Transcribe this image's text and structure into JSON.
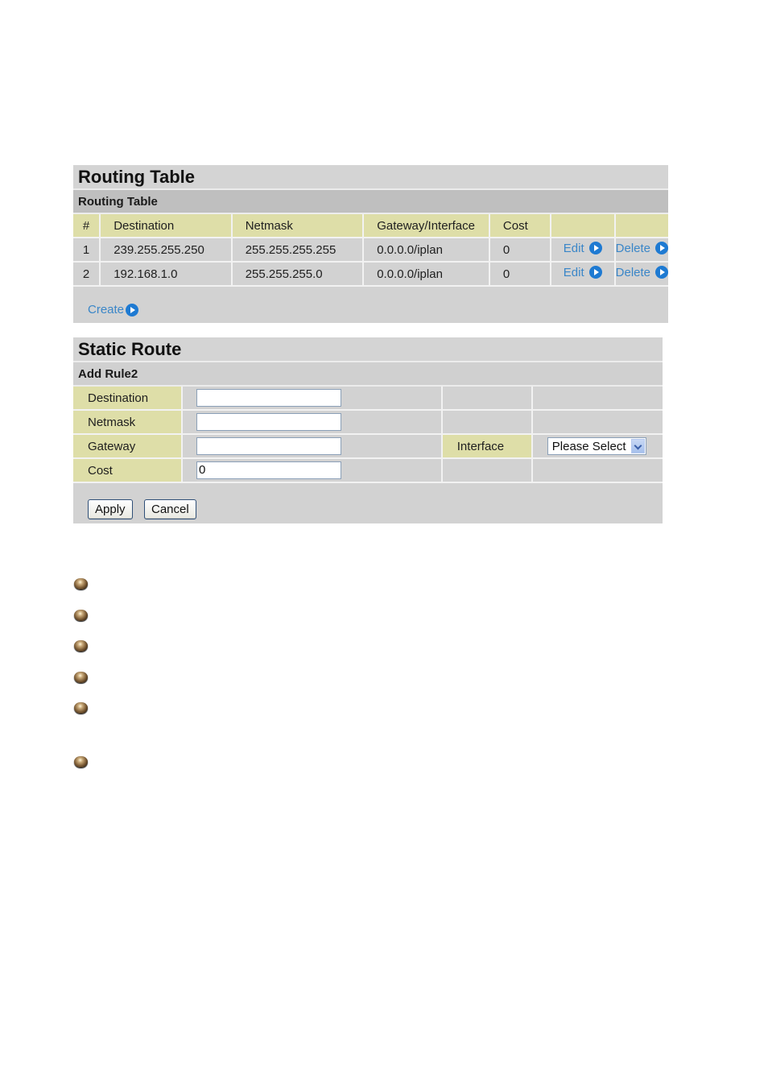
{
  "routing_table": {
    "title": "Routing Table",
    "subtitle": "Routing Table",
    "columns": [
      "#",
      "Destination",
      "Netmask",
      "Gateway/Interface",
      "Cost",
      "",
      ""
    ],
    "rows": [
      {
        "num": "1",
        "destination": "239.255.255.250",
        "netmask": "255.255.255.255",
        "gateway": "0.0.0.0/iplan",
        "cost": "0",
        "edit": "Edit",
        "delete": "Delete"
      },
      {
        "num": "2",
        "destination": "192.168.1.0",
        "netmask": "255.255.255.0",
        "gateway": "0.0.0.0/iplan",
        "cost": "0",
        "edit": "Edit",
        "delete": "Delete"
      }
    ],
    "create_label": "Create"
  },
  "static_route": {
    "title": "Static Route",
    "subtitle": "Add Rule2",
    "fields": {
      "destination": {
        "label": "Destination",
        "value": ""
      },
      "netmask": {
        "label": "Netmask",
        "value": ""
      },
      "gateway": {
        "label": "Gateway",
        "value": ""
      },
      "cost": {
        "label": "Cost",
        "value": "0"
      }
    },
    "interface": {
      "label": "Interface",
      "selected": "Please Select"
    },
    "apply_label": "Apply",
    "cancel_label": "Cancel"
  },
  "bullets": {
    "count": 6,
    "icon": "bronze-sphere-bullet-icon"
  },
  "colors": {
    "panel_bg": "#d2d2d2",
    "header_yellow": "#dedea8",
    "link_blue": "#3a86c8",
    "icon_blue": "#1e7ad2"
  }
}
